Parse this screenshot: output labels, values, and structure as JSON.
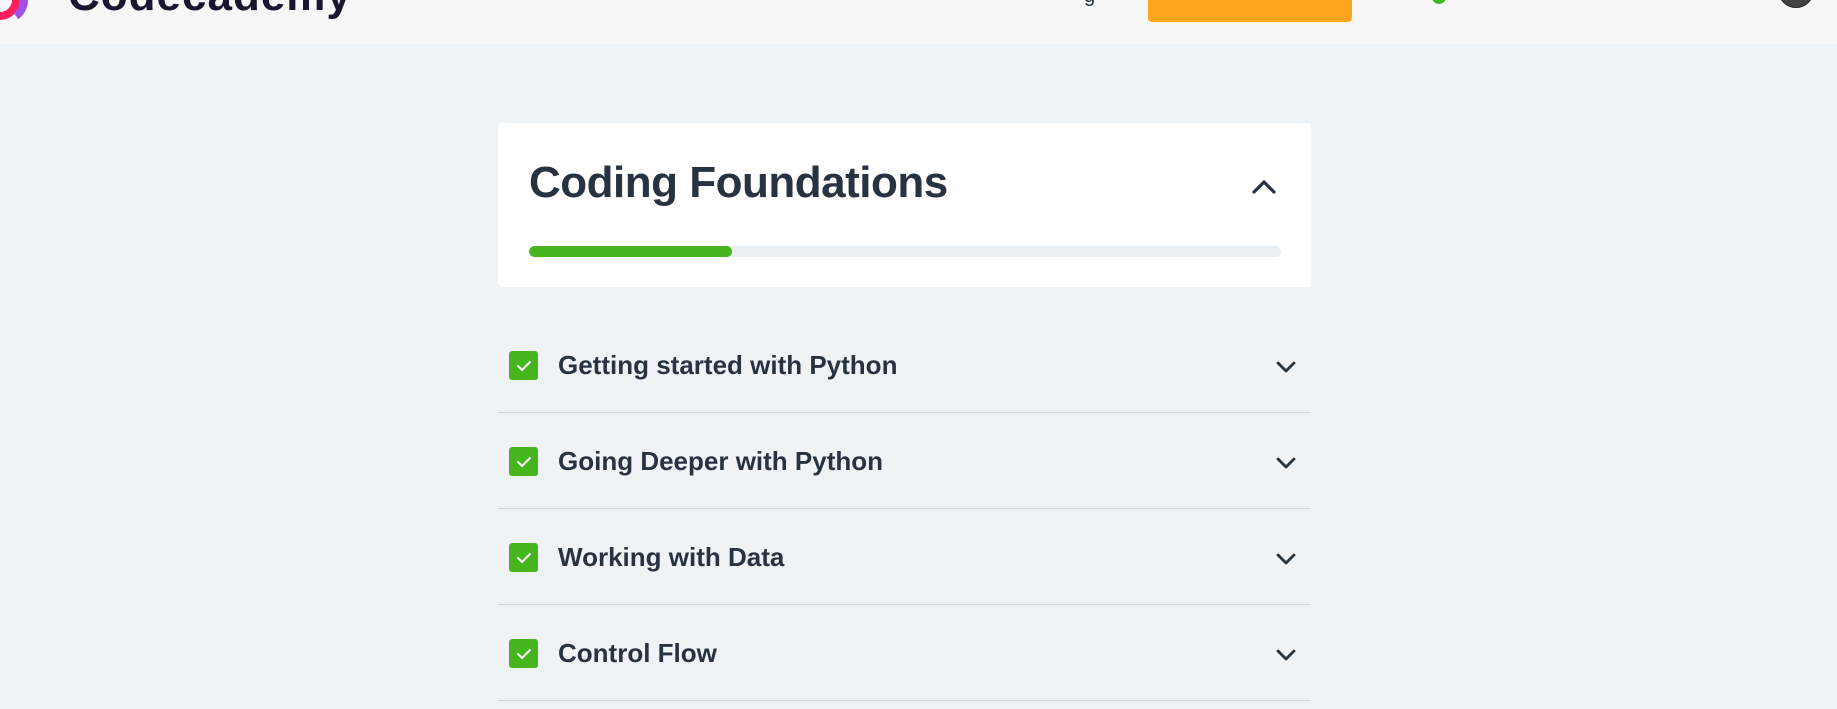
{
  "header": {
    "brand_name": "Codecademy",
    "nav_fragment": "g",
    "cta_label": "",
    "brand_colors": {
      "primary": "#ff1e5a",
      "secondary": "#a050e8"
    },
    "accent_color": "#ffa41c",
    "status_color": "#3dbb1e"
  },
  "course": {
    "title": "Coding Foundations",
    "progress_percent": 27,
    "progress_color": "#47b51d",
    "toggle_icon": "chevron-up-icon"
  },
  "modules": [
    {
      "label": "Getting started with Python",
      "completed": true,
      "icon": "checkmark-icon",
      "toggle_icon": "chevron-down-icon"
    },
    {
      "label": "Going Deeper with Python",
      "completed": true,
      "icon": "checkmark-icon",
      "toggle_icon": "chevron-down-icon"
    },
    {
      "label": "Working with Data",
      "completed": true,
      "icon": "checkmark-icon",
      "toggle_icon": "chevron-down-icon"
    },
    {
      "label": "Control Flow",
      "completed": true,
      "icon": "checkmark-icon",
      "toggle_icon": "chevron-down-icon"
    }
  ]
}
